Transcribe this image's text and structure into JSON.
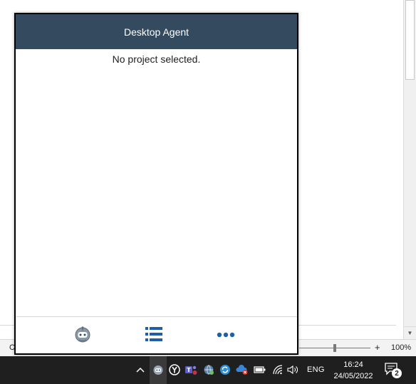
{
  "agent": {
    "title": "Desktop Agent",
    "empty_message": "No project selected.",
    "header_color": "#344a5f",
    "accent_color": "#1f5fa8",
    "footer": {
      "buttons": [
        {
          "icon": "robot-icon"
        },
        {
          "icon": "list-icon"
        },
        {
          "icon": "more-icon"
        }
      ]
    }
  },
  "background_app": {
    "status_left": "C",
    "zoom": {
      "minus_label": "−",
      "plus_label": "+",
      "percent": "100%",
      "level": 0.5
    }
  },
  "taskbar": {
    "language": "ENG",
    "time": "16:24",
    "date": "24/05/2022",
    "notification_count": "2",
    "tray_icons": [
      "chevron-up-icon",
      "agent-robot-icon",
      "ylogo-icon",
      "teams-icon",
      "globe-shield-icon",
      "sync-icon",
      "cloud-error-icon",
      "battery-icon",
      "wifi-icon",
      "volume-icon"
    ]
  }
}
